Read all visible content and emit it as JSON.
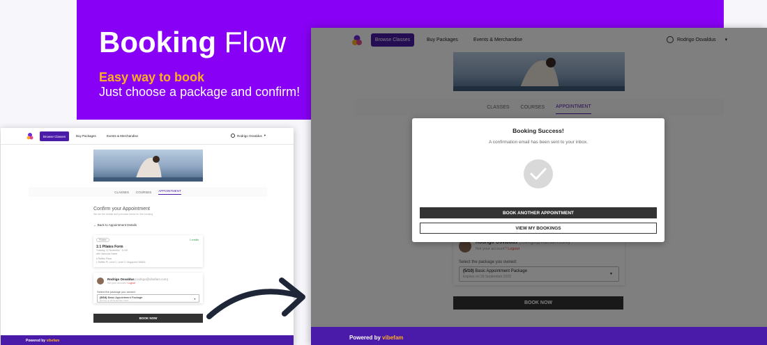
{
  "hero": {
    "title_bold": "Booking",
    "title_rest": "Flow",
    "subtitle_highlight": "Easy way to book",
    "subtitle": "Just choose a package and confirm!"
  },
  "nav": {
    "browse": "Browse Classes",
    "packages": "Buy Packages",
    "events": "Events & Merchandise",
    "user": "Rodrigo Osvaldus"
  },
  "tabs": {
    "classes": "CLASSES",
    "courses": "COURSES",
    "appointment": "APPOINTMENT"
  },
  "left_screen": {
    "confirm_title": "Confirm your Appointment",
    "confirm_sub": "We are the details and purchase below for this booking",
    "back_link": "Back to Appointment Details",
    "appointment": {
      "tag": "Pilates",
      "credits": "1 credits",
      "title": "1:1 Pilates Form",
      "date": "Tuesday, 22 November · 10:30",
      "instructor": "with Instructor Name",
      "location": "6 Raffles Place",
      "address": "1 Raffles Pl, Level 2, Level 2, Singapore 048616"
    },
    "book_now": "BOOK NOW"
  },
  "account": {
    "name": "Rodrigo Osvaldus",
    "email": "(rodrigo@vibefam.com)",
    "not_you": "Not your account?",
    "logout": "Logout",
    "select_label": "Select the package you owned:",
    "package_count": "(5/10)",
    "package_name": "Basic Appointment Package",
    "expires": "Expires on 29 September 2023"
  },
  "modal": {
    "title": "Booking Success!",
    "message": "A confirmation email has been sent to your inbox.",
    "primary_button": "BOOK ANOTHER APPOINTMENT",
    "secondary_button": "VIEW MY BOOKINGS"
  },
  "right_screen": {
    "book_now": "BOOK NOW"
  },
  "footer": {
    "powered": "Powered by",
    "brand": "vibefam"
  },
  "colors": {
    "hero": "#8800f5",
    "primary": "#4a1aa8",
    "highlight": "#ffb020",
    "dark_button": "#333333"
  }
}
